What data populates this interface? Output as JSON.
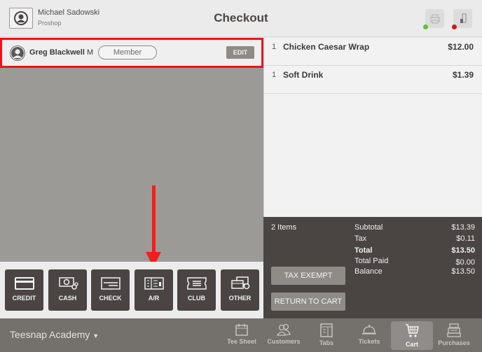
{
  "header": {
    "user_name": "Michael Sadowski",
    "user_role": "Proshop",
    "title": "Checkout",
    "printer_status_color": "#5fc13a",
    "drawer_status_color": "#d2161b"
  },
  "customer": {
    "name": "Greg Blackwell",
    "initial": "M",
    "membership": "Member",
    "edit_label": "EDIT"
  },
  "payment_methods": [
    {
      "label": "CREDIT",
      "icon": "credit-card-icon"
    },
    {
      "label": "CASH",
      "icon": "cash-icon"
    },
    {
      "label": "CHECK",
      "icon": "check-icon"
    },
    {
      "label": "A/R",
      "icon": "accounts-receivable-icon"
    },
    {
      "label": "CLUB",
      "icon": "club-ticket-icon"
    },
    {
      "label": "OTHER",
      "icon": "other-payment-icon"
    }
  ],
  "cart": {
    "items": [
      {
        "qty": "1",
        "name": "Chicken Caesar Wrap",
        "price": "$12.00"
      },
      {
        "qty": "1",
        "name": "Soft Drink",
        "price": "$1.39"
      }
    ]
  },
  "summary": {
    "items_count": "2 Items",
    "subtotal_label": "Subtotal",
    "subtotal": "$13.39",
    "tax_label": "Tax",
    "tax": "$0.11",
    "total_label": "Total",
    "total": "$13.50",
    "total_paid_label": "Total Paid",
    "total_paid": "$0.00",
    "balance_label": "Balance",
    "balance": "$13.50",
    "tax_exempt_label": "TAX EXEMPT",
    "return_label": "RETURN TO CART"
  },
  "bottom_nav": {
    "club_name": "Teesnap Academy",
    "items": [
      {
        "label": "Tee Sheet",
        "icon": "calendar-icon"
      },
      {
        "label": "Customers",
        "icon": "customers-icon"
      },
      {
        "label": "Tabs",
        "icon": "tabs-icon"
      },
      {
        "label": "Tickets",
        "icon": "service-bell-icon"
      },
      {
        "label": "Cart",
        "icon": "cart-icon",
        "active": true
      },
      {
        "label": "Purchases",
        "icon": "cash-register-icon"
      }
    ]
  }
}
